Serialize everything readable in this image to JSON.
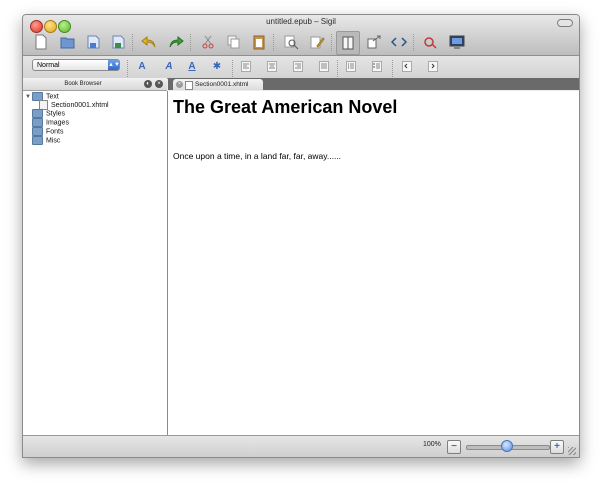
{
  "window": {
    "title": "untitled.epub – Sigil"
  },
  "toolbar": {
    "icons": [
      "new-icon",
      "open-icon",
      "save-icon",
      "save-as-icon",
      "undo-icon",
      "redo-icon",
      "cut-icon",
      "copy-icon",
      "paste-icon",
      "find-icon",
      "meta-editor-icon",
      "book-view-icon",
      "split-view-icon",
      "code-view-icon",
      "spellcheck-icon",
      "preview-icon"
    ]
  },
  "format": {
    "style_select": "Normal"
  },
  "book_browser": {
    "title": "Book Browser",
    "tree": [
      {
        "label": "Text",
        "type": "folder",
        "expanded": true
      },
      {
        "label": "Section0001.xhtml",
        "type": "file"
      },
      {
        "label": "Styles",
        "type": "folder"
      },
      {
        "label": "Images",
        "type": "folder"
      },
      {
        "label": "Fonts",
        "type": "folder"
      },
      {
        "label": "Misc",
        "type": "folder"
      }
    ]
  },
  "tabs": [
    {
      "label": "Section0001.xhtml",
      "active": true
    }
  ],
  "document": {
    "heading": "The Great American Novel",
    "paragraph": "Once upon a time, in a land far, far, away......"
  },
  "status": {
    "zoom": "100%",
    "zoom_minus": "−",
    "zoom_plus": "+",
    "zoom_slider_fraction": 0.5
  }
}
